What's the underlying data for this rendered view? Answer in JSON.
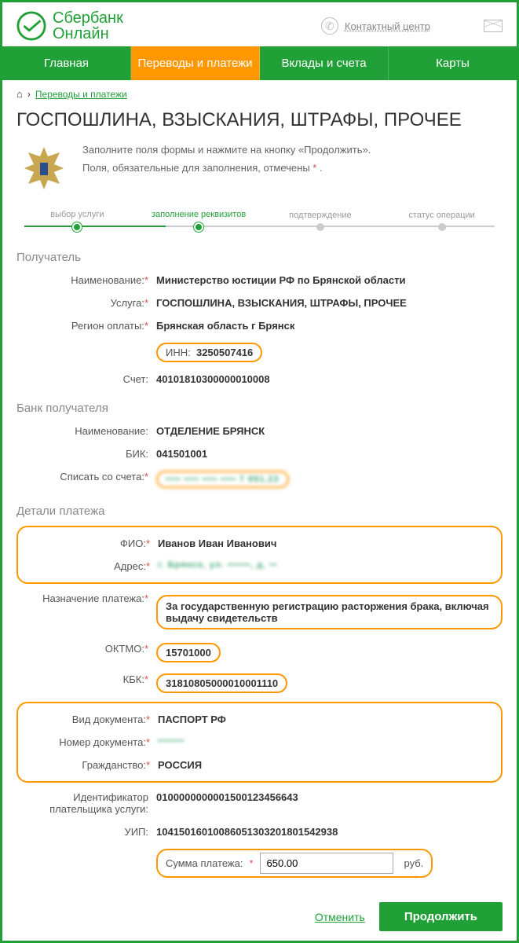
{
  "header": {
    "brand1": "Сбербанк",
    "brand2": "Онлайн",
    "contact": "Контактный центр"
  },
  "nav": [
    "Главная",
    "Переводы и платежи",
    "Вклады и счета",
    "Карты"
  ],
  "crumbs": {
    "link": "Переводы и платежи"
  },
  "title": "ГОСПОШЛИНА, ВЗЫСКАНИЯ, ШТРАФЫ, ПРОЧЕЕ",
  "intro": {
    "l1": "Заполните поля формы и нажмите на кнопку «Продолжить».",
    "l2a": "Поля, обязательные для заполнения, отмечены ",
    "l2b": "*",
    "l2c": " ."
  },
  "steps": [
    "выбор услуги",
    "заполнение реквизитов",
    "подтверждение",
    "статус операции"
  ],
  "s1": {
    "title": "Получатель",
    "name_l": "Наименование:",
    "name_v": "Министерство юстиции РФ по Брянской области",
    "svc_l": "Услуга:",
    "svc_v": "ГОСПОШЛИНА, ВЗЫСКАНИЯ, ШТРАФЫ, ПРОЧЕЕ",
    "reg_l": "Регион оплаты:",
    "reg_v": "Брянская область г Брянск",
    "inn_l": "ИНН:",
    "inn_v": "3250507416",
    "acc_l": "Счет:",
    "acc_v": "40101810300000010008"
  },
  "s2": {
    "title": "Банк получателя",
    "name_l": "Наименование:",
    "name_v": "ОТДЕЛЕНИЕ БРЯНСК",
    "bik_l": "БИК:",
    "bik_v": "041501001",
    "from_l": "Списать со счета:",
    "from_v": "•••• •••• •••• ••••   7 891.23"
  },
  "s3": {
    "title": "Детали платежа",
    "fio_l": "ФИО:",
    "fio_v": "Иванов Иван Иванович",
    "addr_l": "Адрес:",
    "addr_v": "г. Брянск, ул. ••••••, д. ••",
    "purp_l": "Назначение платежа:",
    "purp_v": "За государственную регистрацию расторжения брака, включая выдачу свидетельств",
    "oktmo_l": "ОКТМО:",
    "oktmo_v": "15701000",
    "kbk_l": "КБК:",
    "kbk_v": "31810805000010001110",
    "doc_l": "Вид документа:",
    "doc_v": "ПАСПОРТ РФ",
    "docn_l": "Номер документа:",
    "docn_v": "•••••••",
    "cit_l": "Гражданство:",
    "cit_v": "РОССИЯ",
    "id_l": "Идентификатор плательщика услуги:",
    "id_v": "0100000000001500123456643",
    "uip_l": "УИП:",
    "uip_v": "10415016010086051303201801542938",
    "sum_l": "Сумма платежа:",
    "sum_v": "650.00",
    "sum_u": "руб."
  },
  "btns": {
    "cancel": "Отменить",
    "cont": "Продолжить"
  }
}
